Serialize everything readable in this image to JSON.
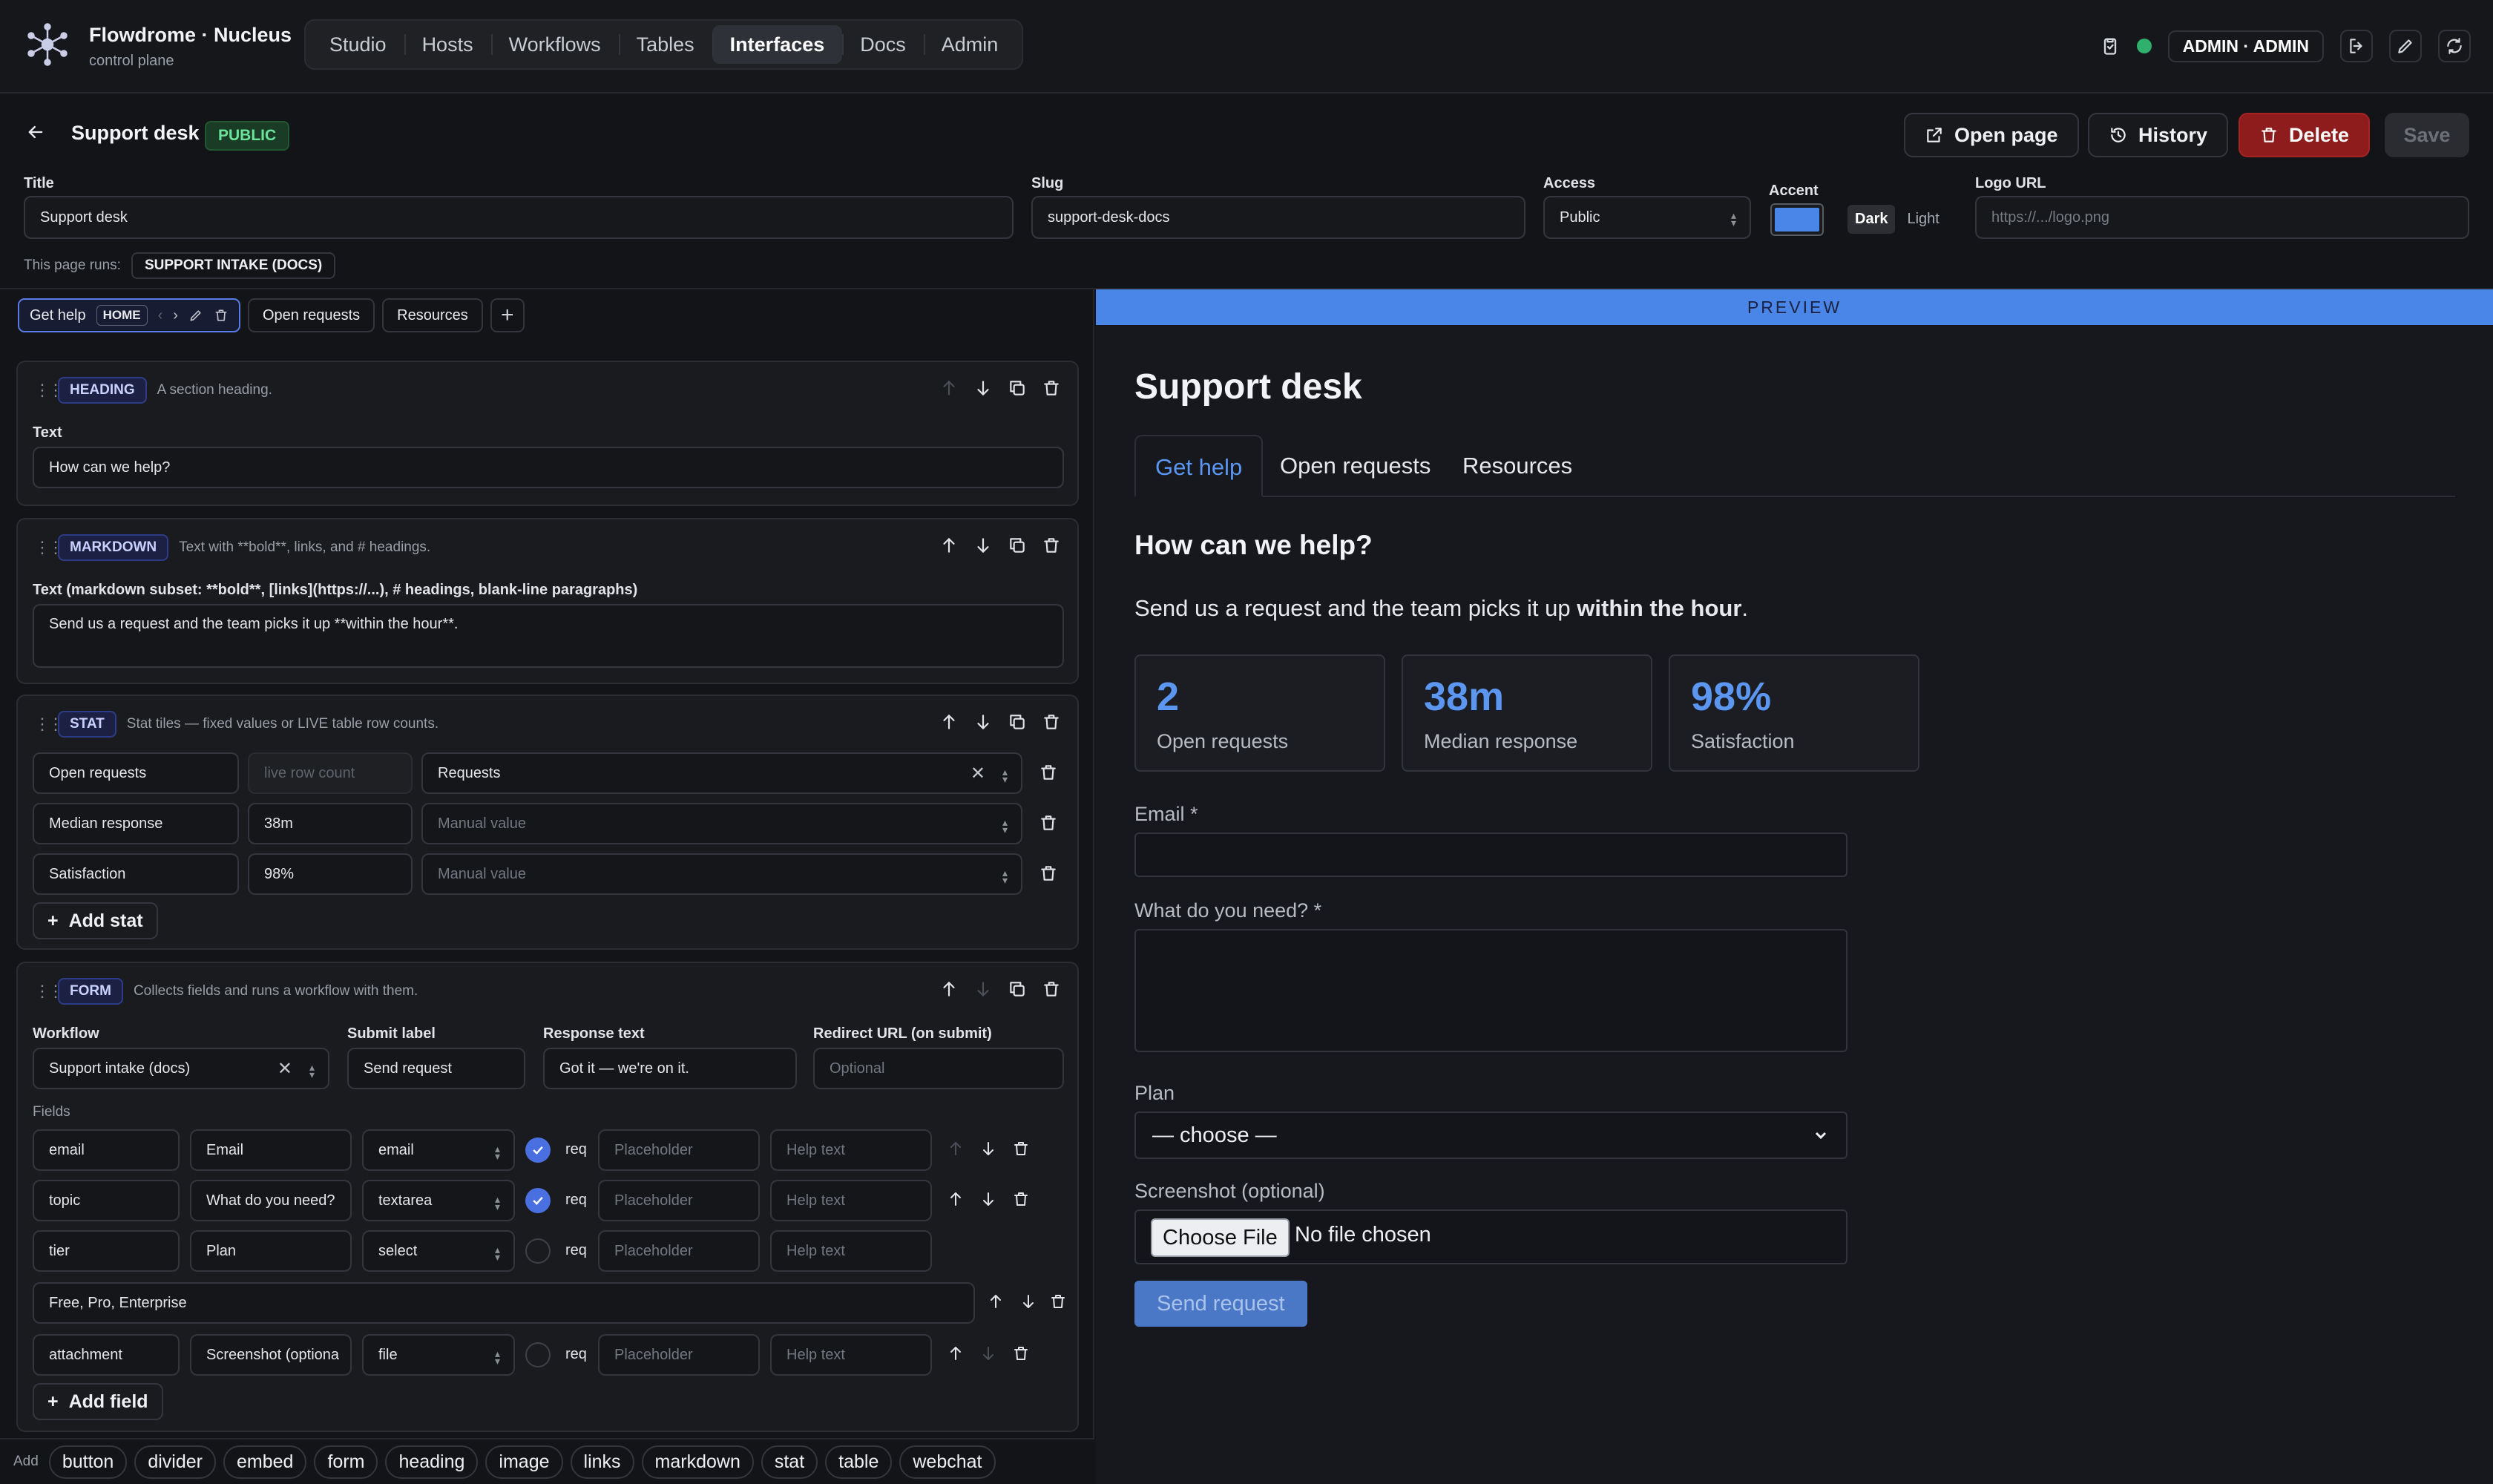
{
  "app": {
    "name": "Flowdrome · Nucleus",
    "subtitle": "control plane"
  },
  "nav": {
    "items": [
      "Studio",
      "Hosts",
      "Workflows",
      "Tables",
      "Interfaces",
      "Docs",
      "Admin"
    ],
    "active": "Interfaces"
  },
  "user": {
    "label": "ADMIN · ADMIN",
    "status_color": "#2fb06c"
  },
  "page": {
    "name": "Support desk",
    "badge": "PUBLIC",
    "buttons": {
      "open": "Open page",
      "history": "History",
      "delete": "Delete",
      "save": "Save"
    },
    "fields": {
      "title_label": "Title",
      "title_value": "Support desk",
      "slug_label": "Slug",
      "slug_value": "support-desk-docs",
      "access_label": "Access",
      "access_value": "Public",
      "accent_label": "Accent",
      "accent_color": "#4a86e8",
      "theme_dark": "Dark",
      "theme_light": "Light",
      "logo_label": "Logo URL",
      "logo_placeholder": "https://.../logo.png"
    },
    "runs_label": "This page runs:",
    "runs_value": "SUPPORT INTAKE (DOCS)"
  },
  "tabs": {
    "current": "Get help",
    "home_badge": "HOME",
    "others": [
      "Open requests",
      "Resources"
    ]
  },
  "blocks": {
    "heading": {
      "type": "HEADING",
      "desc": "A section heading.",
      "text_label": "Text",
      "text_value": "How can we help?"
    },
    "markdown": {
      "type": "MARKDOWN",
      "desc": "Text with **bold**, links, and # headings.",
      "text_label": "Text (markdown subset: **bold**, [links](https://...), # headings, blank-line paragraphs)",
      "text_value": "Send us a request and the team picks it up **within the hour**."
    },
    "stat": {
      "type": "STAT",
      "desc": "Stat tiles — fixed values or LIVE table row counts.",
      "rows": [
        {
          "label": "Open requests",
          "value": "live row count",
          "source": "Requests"
        },
        {
          "label": "Median response",
          "value": "38m",
          "source": "Manual value"
        },
        {
          "label": "Satisfaction",
          "value": "98%",
          "source": "Manual value"
        }
      ],
      "add_label": "Add stat"
    },
    "form": {
      "type": "FORM",
      "desc": "Collects fields and runs a workflow with them.",
      "workflow_label": "Workflow",
      "workflow_value": "Support intake (docs)",
      "submit_label_label": "Submit label",
      "submit_label_value": "Send request",
      "response_label": "Response text",
      "response_value": "Got it — we're on it.",
      "redirect_label": "Redirect URL (on submit)",
      "redirect_placeholder": "Optional",
      "fields_label": "Fields",
      "req_label": "req",
      "placeholder_ph": "Placeholder",
      "help_ph": "Help text",
      "fields": [
        {
          "key": "email",
          "label": "Email",
          "type": "email",
          "required": true
        },
        {
          "key": "topic",
          "label": "What do you need?",
          "type": "textarea",
          "required": true
        },
        {
          "key": "tier",
          "label": "Plan",
          "type": "select",
          "required": false,
          "options": "Free, Pro, Enterprise"
        },
        {
          "key": "attachment",
          "label": "Screenshot (optiona",
          "type": "file",
          "required": false
        }
      ],
      "add_label": "Add field"
    }
  },
  "add_bar": {
    "label": "Add",
    "items": [
      "button",
      "divider",
      "embed",
      "form",
      "heading",
      "image",
      "links",
      "markdown",
      "stat",
      "table",
      "webchat"
    ]
  },
  "preview": {
    "bar": "PREVIEW",
    "title": "Support desk",
    "tabs": [
      "Get help",
      "Open requests",
      "Resources"
    ],
    "heading": "How can we help?",
    "para_plain": "Send us a request and the team picks it up",
    "para_bold": "within the hour",
    "para_end": ".",
    "stats": [
      {
        "value": "2",
        "label": "Open requests"
      },
      {
        "value": "38m",
        "label": "Median response"
      },
      {
        "value": "98%",
        "label": "Satisfaction"
      }
    ],
    "email_label": "Email *",
    "need_label": "What do you need? *",
    "plan_label": "Plan",
    "plan_value": "— choose —",
    "file_label": "Screenshot (optional)",
    "file_button": "Choose File",
    "file_none": "No file chosen",
    "submit": "Send request"
  }
}
